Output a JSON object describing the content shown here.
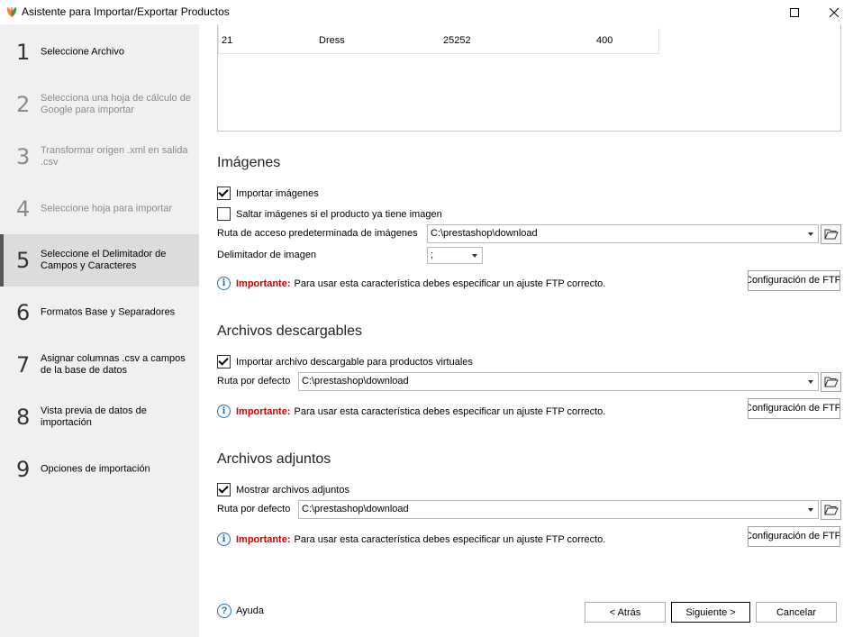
{
  "window": {
    "title": "Asistente para Importar/Exportar Productos"
  },
  "steps": [
    {
      "num": "1",
      "label": "Seleccione Archivo"
    },
    {
      "num": "2",
      "label": "Selecciona una hoja de cálculo de Google para importar"
    },
    {
      "num": "3",
      "label": "Transformar origen .xml en salida .csv"
    },
    {
      "num": "4",
      "label": "Seleccione hoja para importar"
    },
    {
      "num": "5",
      "label": "Seleccione el Delimitador de Campos y Caracteres"
    },
    {
      "num": "6",
      "label": "Formatos Base y Separadores"
    },
    {
      "num": "7",
      "label": "Asignar columnas .csv a campos de la base de datos"
    },
    {
      "num": "8",
      "label": "Vista previa de datos de importación"
    },
    {
      "num": "9",
      "label": "Opciones de importación"
    }
  ],
  "preview": {
    "row": [
      "21",
      "Dress",
      "25252",
      "400"
    ]
  },
  "images": {
    "title": "Imágenes",
    "import_label": "Importar imágenes",
    "import_checked": true,
    "skip_label": "Saltar imágenes si el producto ya tiene imagen",
    "skip_checked": false,
    "path_label": "Ruta de acceso predeterminada de imágenes",
    "path_value": "C:\\prestashop\\download",
    "delimiter_label": "Delimitador de imagen",
    "delimiter_value": ";",
    "important_label": "Importante:",
    "important_text": "Para usar esta característica debes especificar un ajuste FTP correcto.",
    "ftp_button": "Configuración de FTP"
  },
  "downloads": {
    "title": "Archivos descargables",
    "import_label": "Importar archivo descargable para productos virtuales",
    "import_checked": true,
    "path_label": "Ruta por defecto",
    "path_value": "C:\\prestashop\\download",
    "important_label": "Importante:",
    "important_text": "Para usar esta característica debes especificar un ajuste FTP correcto.",
    "ftp_button": "Configuración de FTP"
  },
  "attachments": {
    "title": "Archivos adjuntos",
    "show_label": "Mostrar archivos adjuntos",
    "show_checked": true,
    "path_label": "Ruta por defecto",
    "path_value": "C:\\prestashop\\download",
    "important_label": "Importante:",
    "important_text": "Para usar esta característica debes especificar un ajuste FTP correcto.",
    "ftp_button": "Configuración de FTP"
  },
  "footer": {
    "help_label": "Ayuda",
    "back_label": "< Atrás",
    "next_label": "Siguiente >",
    "cancel_label": "Cancelar"
  }
}
